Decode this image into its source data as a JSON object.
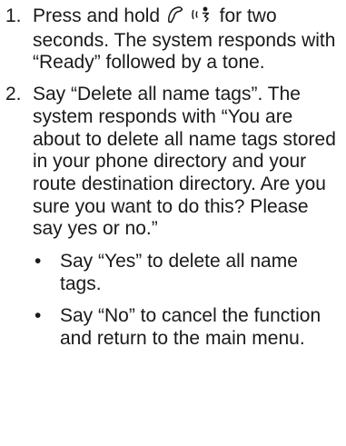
{
  "steps": [
    {
      "number": "1.",
      "text_before_icons": "Press and hold ",
      "icons": [
        "phone-handset-icon",
        "voice-speech-icon"
      ],
      "text_after_icons": " for two seconds. The system responds with “Ready” followed by a tone."
    },
    {
      "number": "2.",
      "text": "Say “Delete all name tags”. The system responds with “You are about to delete all name tags stored in your phone directory and your route destination directory. Are you sure you want to do this? Please say yes or no.”",
      "bullets": [
        {
          "marker": "•",
          "text": "Say “Yes” to delete all name tags."
        },
        {
          "marker": "•",
          "text": "Say “No” to cancel the function and return to the main menu."
        }
      ]
    }
  ]
}
